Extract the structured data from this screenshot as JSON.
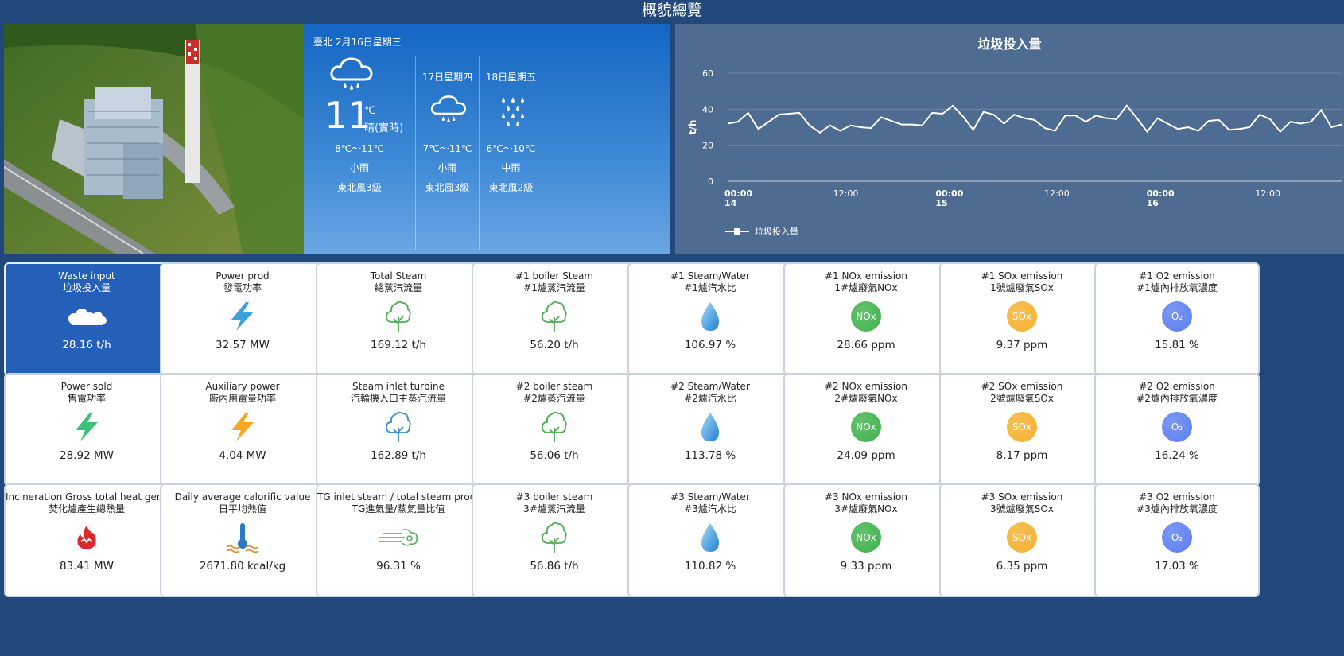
{
  "header": {
    "title": "概貌總覽"
  },
  "weather": {
    "location_date": "臺北 2月16日星期三",
    "today": {
      "temp": "11",
      "unit": "℃",
      "desc": "晴(實時)",
      "range": "8℃～11℃",
      "cond": "小雨",
      "wind": "東北風3級",
      "icon": "rain-cloud-icon"
    },
    "days": [
      {
        "name": "17日星期四",
        "range": "7℃～11℃",
        "cond": "小雨",
        "wind": "東北風3級",
        "icon": "rain-cloud-icon"
      },
      {
        "name": "18日星期五",
        "range": "6℃～10℃",
        "cond": "中雨",
        "wind": "東北風2級",
        "icon": "heavy-rain-icon"
      }
    ]
  },
  "chart_data": {
    "type": "line",
    "title": "垃圾投入量",
    "ylabel": "t/h",
    "xlabel": "",
    "ylim": [
      0,
      60
    ],
    "yticks": [
      0,
      20,
      40,
      60
    ],
    "xticks": [
      {
        "l1": "00:00",
        "l2": "14",
        "bold": true
      },
      {
        "l1": "12:00",
        "l2": "",
        "bold": false
      },
      {
        "l1": "00:00",
        "l2": "15",
        "bold": true
      },
      {
        "l1": "12:00",
        "l2": "",
        "bold": false
      },
      {
        "l1": "00:00",
        "l2": "16",
        "bold": true
      },
      {
        "l1": "12:00",
        "l2": "",
        "bold": false
      }
    ],
    "x_hours": [
      0,
      2,
      4,
      6,
      8,
      10,
      12,
      14,
      16,
      18,
      20,
      22,
      24,
      26,
      28,
      30,
      32,
      34,
      36,
      38,
      40,
      42,
      44,
      46,
      48,
      50,
      52,
      54,
      56,
      58,
      60,
      62,
      64,
      66,
      68,
      70,
      72,
      74,
      76,
      78,
      80,
      82,
      84,
      86,
      88,
      90,
      92,
      94,
      96,
      98,
      100,
      102,
      104,
      106,
      108,
      110,
      112,
      114,
      116,
      118,
      120,
      122,
      124,
      126,
      128,
      130,
      132,
      134,
      136,
      138,
      140,
      142,
      144
    ],
    "series": [
      {
        "name": "垃圾投入量",
        "color": "#ffffff",
        "values": [
          32,
          33,
          38,
          29,
          33,
          37,
          37.5,
          38,
          31,
          27,
          31,
          28,
          31,
          30,
          29.5,
          35.5,
          33.5,
          31.5,
          31.5,
          31,
          38,
          37.5,
          42,
          36,
          28.5,
          38.5,
          37,
          32,
          37,
          35,
          34,
          29.5,
          28,
          36.5,
          36.5,
          33,
          36.5,
          35,
          34.5,
          42,
          35,
          27.5,
          35,
          32,
          29,
          30,
          28,
          33.5,
          34,
          28.5,
          29,
          30,
          37,
          34.5,
          27.5,
          33,
          32,
          33,
          39.5,
          30,
          31.5
        ]
      }
    ],
    "legend": "bottom-left"
  },
  "cards": [
    {
      "l1": "Waste input",
      "l2": "垃圾投入量",
      "value": "28.16 t/h",
      "icon": "waste-pile-icon",
      "active": true
    },
    {
      "l1": "Power prod",
      "l2": "發電功率",
      "value": "32.57 MW",
      "icon": "lightning-icon",
      "color": "#3aa0d8"
    },
    {
      "l1": "Total Steam",
      "l2": "總蒸汽流量",
      "value": "169.12 t/h",
      "icon": "steam-tree-icon",
      "color": "#4caf50"
    },
    {
      "l1": "#1 boiler Steam",
      "l2": "#1爐蒸汽流量",
      "value": "56.20 t/h",
      "icon": "steam-tree-icon",
      "color": "#4caf50"
    },
    {
      "l1": "#1 Steam/Water",
      "l2": "#1爐汽水比",
      "value": "106.97 %",
      "icon": "water-drop-icon"
    },
    {
      "l1": "#1 NOx emission",
      "l2": "1#爐廢氣NOx",
      "value": "28.66 ppm",
      "icon": "nox-badge-icon",
      "badge": "NOx",
      "color": "#3db24a"
    },
    {
      "l1": "#1 SOx emission",
      "l2": "1號爐廢氣SOx",
      "value": "9.37 ppm",
      "icon": "sox-badge-icon",
      "badge": "SOx",
      "color": "#f5b02e"
    },
    {
      "l1": "#1 O2 emission",
      "l2": "#1爐內排放氧濃度",
      "value": "15.81 %",
      "icon": "o2-badge-icon",
      "badge": "O₂",
      "color": "#5b7ef0"
    },
    {
      "l1": "Power sold",
      "l2": "售電功率",
      "value": "28.92 MW",
      "icon": "lightning-icon",
      "color": "#3cc07a"
    },
    {
      "l1": "Auxiliary power",
      "l2": "廠內用電量功率",
      "value": "4.04 MW",
      "icon": "lightning-icon",
      "color": "#f5a623"
    },
    {
      "l1": "Steam inlet turbine",
      "l2": "汽輪機入口主蒸汽流量",
      "value": "162.89 t/h",
      "icon": "steam-tree-icon",
      "color": "#3a8fd0"
    },
    {
      "l1": "#2 boiler steam",
      "l2": "#2爐蒸汽流量",
      "value": "56.06 t/h",
      "icon": "steam-tree-icon",
      "color": "#4caf50"
    },
    {
      "l1": "#2 Steam/Water",
      "l2": "#2爐汽水比",
      "value": "113.78 %",
      "icon": "water-drop-icon"
    },
    {
      "l1": "#2 NOx emission",
      "l2": "2#爐廢氣NOx",
      "value": "24.09 ppm",
      "icon": "nox-badge-icon",
      "badge": "NOx",
      "color": "#3db24a"
    },
    {
      "l1": "#2 SOx emission",
      "l2": "2號爐廢氣SOx",
      "value": "8.17 ppm",
      "icon": "sox-badge-icon",
      "badge": "SOx",
      "color": "#f5b02e"
    },
    {
      "l1": "#2 O2 emission",
      "l2": "#2爐內排放氧濃度",
      "value": "16.24 %",
      "icon": "o2-badge-icon",
      "badge": "O₂",
      "color": "#5b7ef0"
    },
    {
      "l1": "Incineration Gross total heat generated",
      "l2": "焚化爐產生總熱量",
      "value": "83.41 MW",
      "icon": "flame-icon",
      "color": "#e0282c"
    },
    {
      "l1": "Daily average calorific value",
      "l2": "日平均熱值",
      "value": "2671.80 kcal/kg",
      "icon": "thermometer-icon",
      "color": "#2a78c8"
    },
    {
      "l1": "TG inlet steam / total steam produced ratio",
      "l2": "TG進氣量/蒸氣量比值",
      "value": "96.31 %",
      "icon": "steam-flow-icon",
      "color": "#4caf50"
    },
    {
      "l1": "#3 boiler steam",
      "l2": "3#爐蒸汽流量",
      "value": "56.86 t/h",
      "icon": "steam-tree-icon",
      "color": "#4caf50"
    },
    {
      "l1": "#3 Steam/Water",
      "l2": "#3爐汽水比",
      "value": "110.82 %",
      "icon": "water-drop-icon"
    },
    {
      "l1": "#3 NOx emission",
      "l2": "3#爐廢氣NOx",
      "value": "9.33 ppm",
      "icon": "nox-badge-icon",
      "badge": "NOx",
      "color": "#3db24a"
    },
    {
      "l1": "#3 SOx emission",
      "l2": "3號爐廢氣SOx",
      "value": "6.35 ppm",
      "icon": "sox-badge-icon",
      "badge": "SOx",
      "color": "#f5b02e"
    },
    {
      "l1": "#3 O2 emission",
      "l2": "#3爐內排放氧濃度",
      "value": "17.03 %",
      "icon": "o2-badge-icon",
      "badge": "O₂",
      "color": "#5b7ef0"
    }
  ]
}
